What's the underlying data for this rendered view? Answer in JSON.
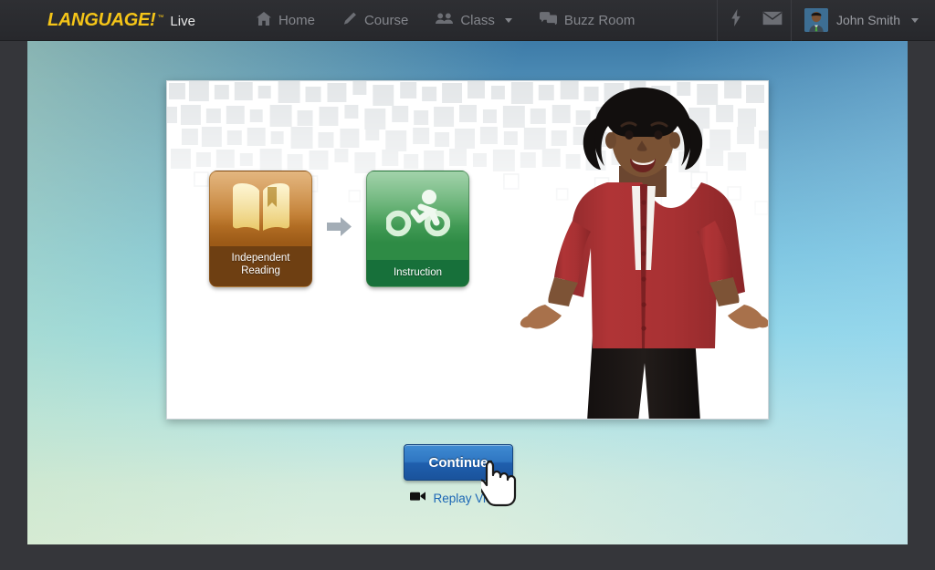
{
  "navbar": {
    "brand": {
      "main": "LANGUAGE!",
      "tm": "™",
      "sub": "Live"
    },
    "links": [
      {
        "label": "Home",
        "icon": "home-icon",
        "caret": false
      },
      {
        "label": "Course",
        "icon": "pencil-icon",
        "caret": false
      },
      {
        "label": "Class",
        "icon": "people-icon",
        "caret": true
      },
      {
        "label": "Buzz Room",
        "icon": "chat-icon",
        "caret": false
      }
    ],
    "actions": [
      {
        "name": "bolt-icon",
        "label": "Activity"
      },
      {
        "name": "envelope-icon",
        "label": "Messages"
      }
    ],
    "user": {
      "name": "John Smith",
      "avatar": "user-avatar",
      "caret": true
    }
  },
  "stage": {
    "tiles": [
      {
        "label": "Independent\nReading",
        "line1": "Independent",
        "line2": "Reading",
        "icon": "open-book-icon",
        "color": "#9c5a17"
      },
      {
        "label": "Instruction",
        "line1": "Instruction",
        "line2": "",
        "icon": "cyclist-icon",
        "color": "#2e8b45"
      }
    ],
    "arrow": "arrow-right-icon",
    "presenter": "presenter-video-figure"
  },
  "actions": {
    "continue_label": "Continue",
    "replay_label": "Replay Video",
    "replay_icon": "video-camera-icon",
    "cursor": "hand-pointer-cursor"
  },
  "colors": {
    "brand_yellow": "#f5c518",
    "nav_bg": "#2e2f33",
    "button_blue": "#2f76c2",
    "link_blue": "#1b66b5",
    "tile_brown": "#9c5a17",
    "tile_green": "#2e8b45"
  }
}
